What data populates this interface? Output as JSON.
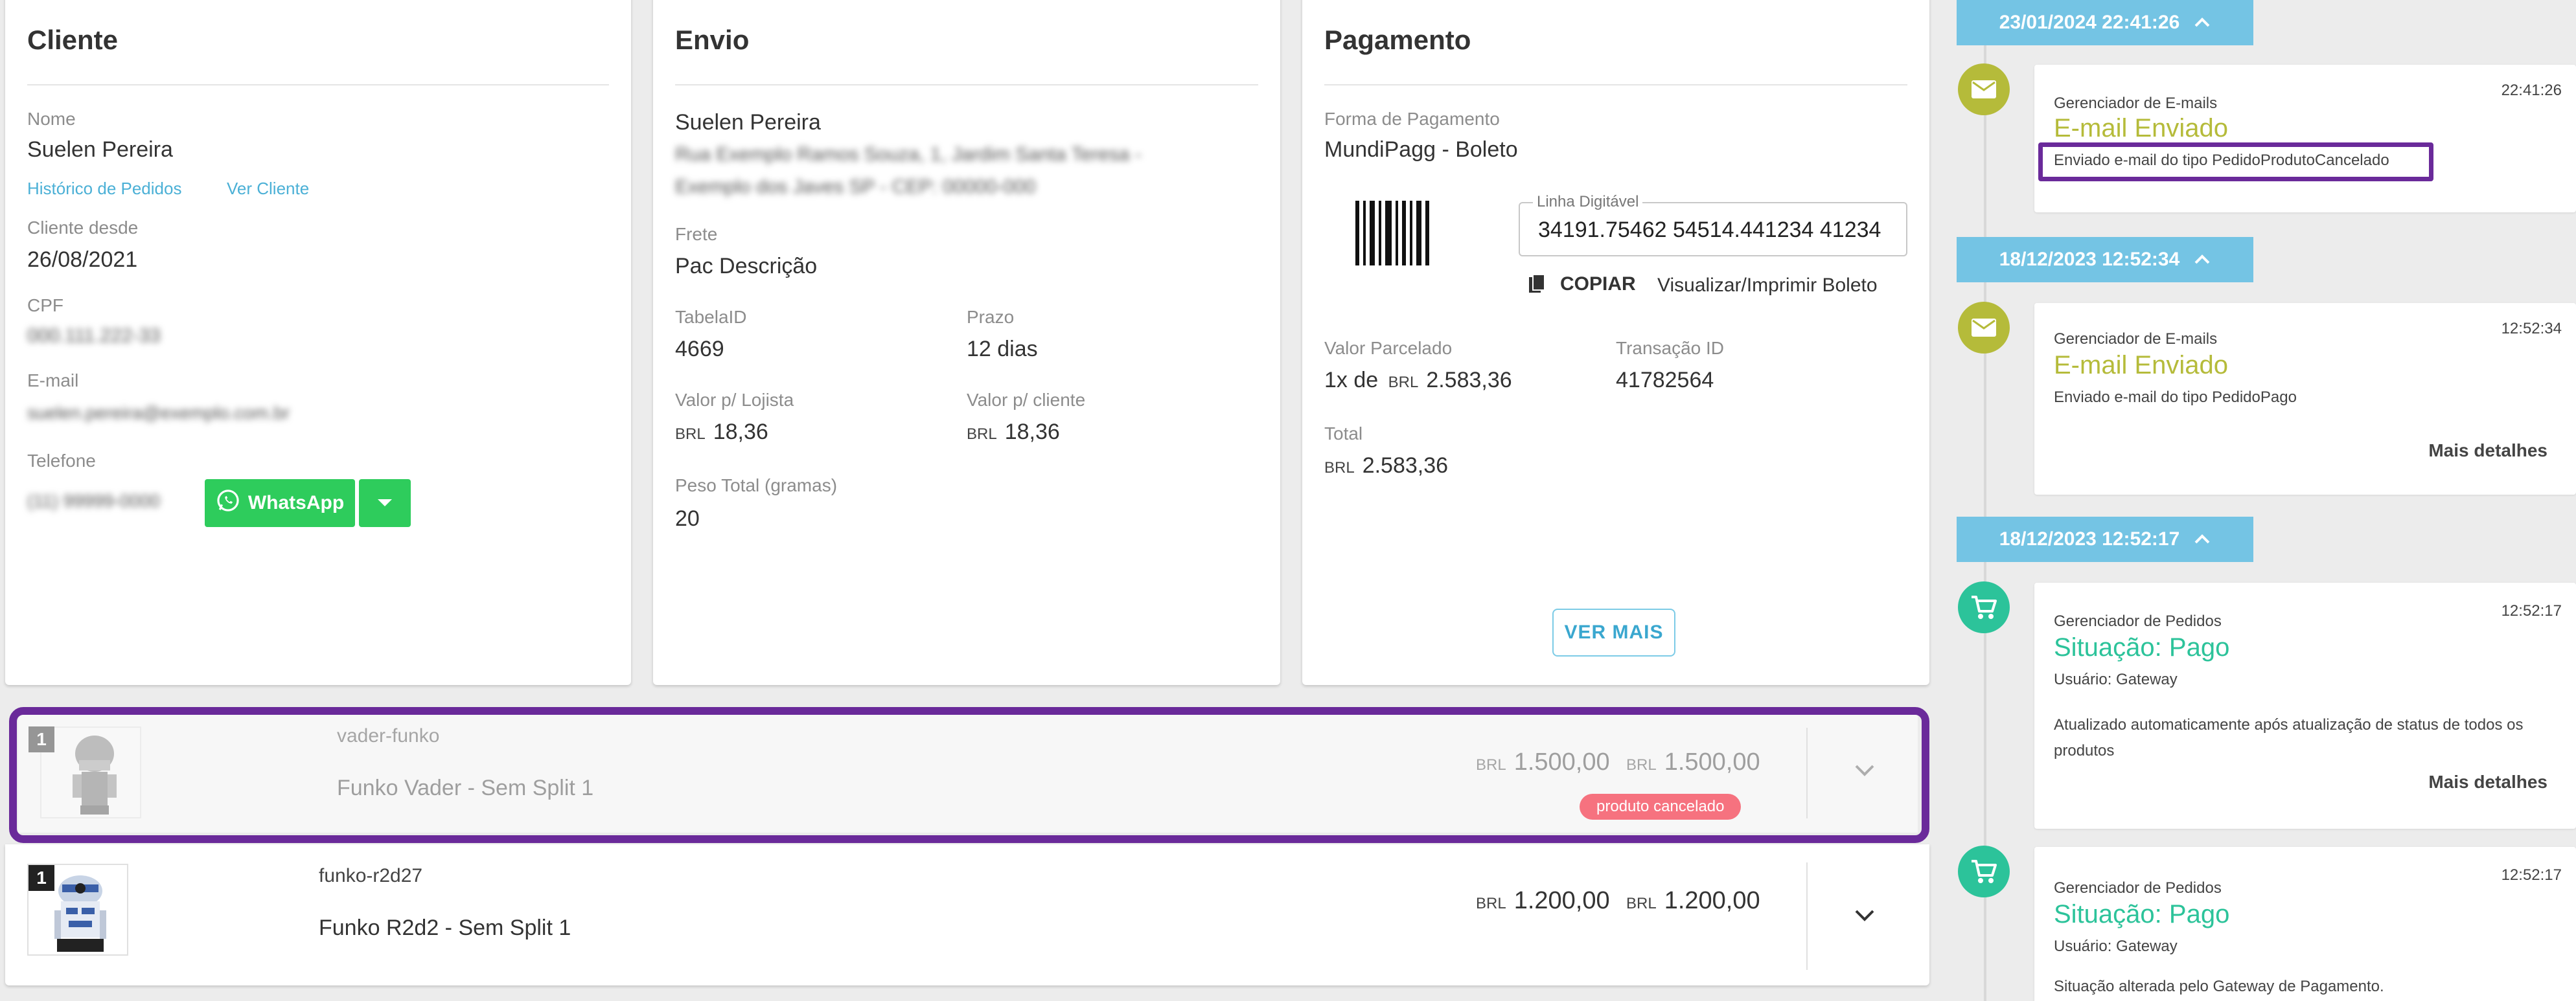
{
  "cliente": {
    "title": "Cliente",
    "nome_label": "Nome",
    "nome": "Suelen Pereira",
    "historico_link": "Histórico de Pedidos",
    "ver_cliente_link": "Ver Cliente",
    "cliente_desde_label": "Cliente desde",
    "cliente_desde": "26/08/2021",
    "cpf_label": "CPF",
    "cpf": "000.111.222-33",
    "email_label": "E-mail",
    "email": "suelen.pereira@exemplo.com.br",
    "telefone_label": "Telefone",
    "telefone": "(11) 99999-0000",
    "whatsapp_button": "WhatsApp"
  },
  "envio": {
    "title": "Envio",
    "nome": "Suelen Pereira",
    "endereco_linha1": "Rua Exemplo Ramos Souza, 1, Jardim Santa Teresa -",
    "endereco_linha2": "Exemplo dos Javes SP - CEP: 00000-000",
    "frete_label": "Frete",
    "frete": "Pac Descrição",
    "tabelaid_label": "TabelaID",
    "tabelaid": "4669",
    "prazo_label": "Prazo",
    "prazo": "12 dias",
    "valor_lojista_label": "Valor p/ Lojista",
    "valor_lojista": "18,36",
    "valor_cliente_label": "Valor p/ cliente",
    "valor_cliente": "18,36",
    "peso_label": "Peso Total (gramas)",
    "peso": "20",
    "currency": "BRL"
  },
  "pagamento": {
    "title": "Pagamento",
    "forma_label": "Forma de Pagamento",
    "forma": "MundiPagg - Boleto",
    "linha_label": "Linha Digitável",
    "linha": "34191.75462 54514.441234 41234",
    "copiar_button": "COPIAR",
    "visualizar_link": "Visualizar/Imprimir Boleto",
    "valor_parcelado_label": "Valor Parcelado",
    "valor_parcelado_prefix": "1x de",
    "valor_parcelado": "2.583,36",
    "transacao_label": "Transação ID",
    "transacao": "41782564",
    "total_label": "Total",
    "total": "2.583,36",
    "ver_mais_button": "VER MAIS",
    "currency": "BRL"
  },
  "produtos": [
    {
      "qty": "1",
      "sku": "vader-funko",
      "name": "Funko Vader - Sem Split 1",
      "currency": "BRL",
      "price_unit": "1.500,00",
      "price_total": "1.500,00",
      "badge": "produto cancelado",
      "cancelled": true
    },
    {
      "qty": "1",
      "sku": "funko-r2d27",
      "name": "Funko R2d2 - Sem Split 1",
      "currency": "BRL",
      "price_unit": "1.200,00",
      "price_total": "1.200,00",
      "cancelled": false
    }
  ],
  "timeline": [
    {
      "date": "23/01/2024 22:41:26",
      "source": "Gerenciador de E-mails",
      "time": "22:41:26",
      "title": "E-mail Enviado",
      "text": "Enviado e-mail do tipo PedidoProdutoCancelado",
      "icon": "email-icon",
      "color": "#b5bb3a"
    },
    {
      "date": "18/12/2023 12:52:34",
      "source": "Gerenciador de E-mails",
      "time": "12:52:34",
      "title": "E-mail Enviado",
      "text": "Enviado e-mail do tipo PedidoPago",
      "more": "Mais detalhes",
      "icon": "email-icon",
      "color": "#b5bb3a"
    },
    {
      "date": "18/12/2023 12:52:17",
      "source": "Gerenciador de Pedidos",
      "time": "12:52:17",
      "title": "Situação: Pago",
      "usuario": "Usuário: Gateway",
      "text_line1": "Atualizado automaticamente após atualização de status de todos os",
      "text_line2": "produtos",
      "more": "Mais detalhes",
      "icon": "cart-icon",
      "color": "#2cc39a"
    },
    {
      "source": "Gerenciador de Pedidos",
      "time": "12:52:17",
      "title": "Situação: Pago",
      "usuario": "Usuário: Gateway",
      "text": "Situação alterada pelo Gateway de Pagamento.",
      "icon": "cart-icon",
      "color": "#2cc39a"
    }
  ]
}
